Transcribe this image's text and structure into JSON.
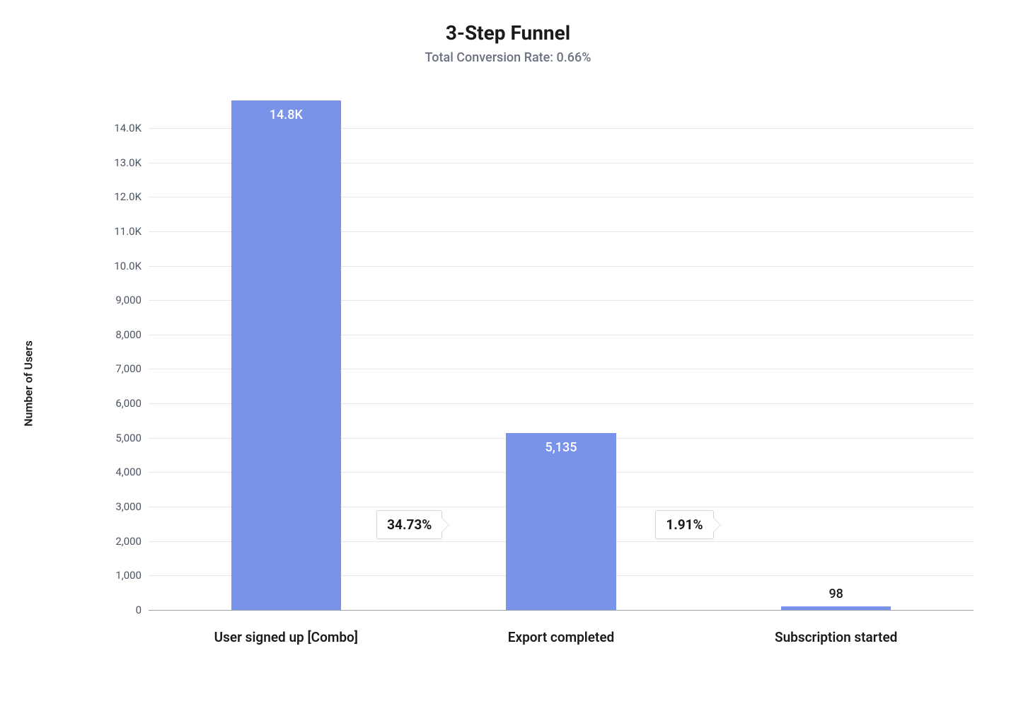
{
  "chart_data": {
    "type": "bar",
    "title": "3-Step Funnel",
    "subtitle": "Total Conversion Rate: 0.66%",
    "ylabel": "Number of Users",
    "xlabel": "",
    "ylim": [
      0,
      14800
    ],
    "y_ticks": [
      {
        "v": 0,
        "label": "0"
      },
      {
        "v": 1000,
        "label": "1,000"
      },
      {
        "v": 2000,
        "label": "2,000"
      },
      {
        "v": 3000,
        "label": "3,000"
      },
      {
        "v": 4000,
        "label": "4,000"
      },
      {
        "v": 5000,
        "label": "5,000"
      },
      {
        "v": 6000,
        "label": "6,000"
      },
      {
        "v": 7000,
        "label": "7,000"
      },
      {
        "v": 8000,
        "label": "8,000"
      },
      {
        "v": 9000,
        "label": "9,000"
      },
      {
        "v": 10000,
        "label": "10.0K"
      },
      {
        "v": 11000,
        "label": "11.0K"
      },
      {
        "v": 12000,
        "label": "12.0K"
      },
      {
        "v": 13000,
        "label": "13.0K"
      },
      {
        "v": 14000,
        "label": "14.0K"
      }
    ],
    "categories": [
      "User signed up [Combo]",
      "Export completed",
      "Subscription started"
    ],
    "values": [
      14800,
      5135,
      98
    ],
    "value_labels": [
      "14.8K",
      "5,135",
      "98"
    ],
    "step_conversions": [
      "34.73%",
      "1.91%"
    ],
    "total_conversion_rate": "0.66%",
    "bar_color": "#7a93ea"
  }
}
